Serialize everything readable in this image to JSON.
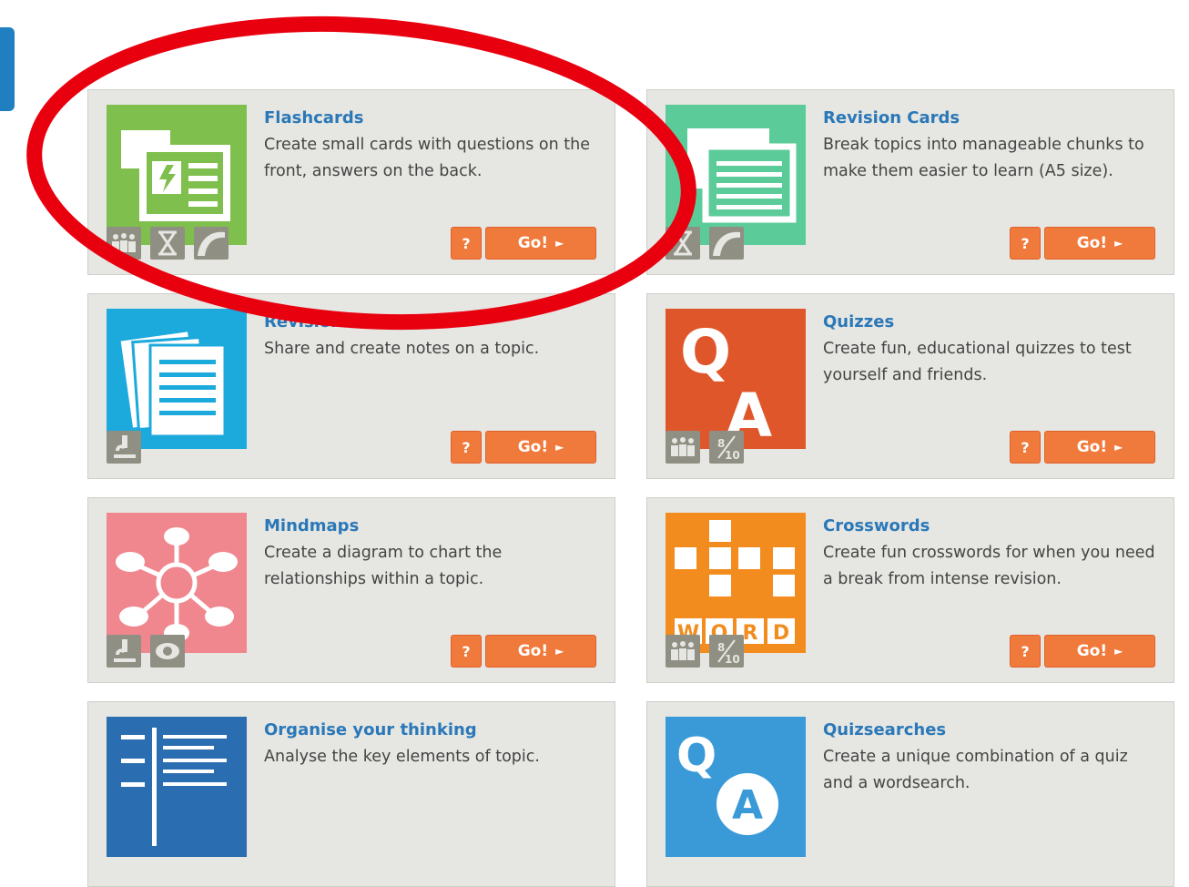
{
  "cards": [
    {
      "title": "Flashcards",
      "desc": "Create small cards with questions on the front, answers on the back.",
      "thumb_color": "#7fbf4d",
      "icon": "flashcards-icon",
      "features": [
        "group-icon",
        "hourglass-icon",
        "curve-icon"
      ]
    },
    {
      "title": "Revision Cards",
      "desc": "Break topics into manageable chunks to make them easier to learn (A5 size).",
      "thumb_color": "#5ccb9a",
      "icon": "revision-cards-icon",
      "features": [
        "hourglass-icon",
        "curve-icon"
      ]
    },
    {
      "title": "Revision notes",
      "desc": "Share and create notes on a topic.",
      "thumb_color": "#1ca9dc",
      "icon": "revision-notes-icon",
      "features": [
        "microscope-icon"
      ]
    },
    {
      "title": "Quizzes",
      "desc": "Create fun, educational quizzes to test yourself and friends.",
      "thumb_color": "#e0562b",
      "icon": "quiz-qa-icon",
      "features": [
        "group-icon",
        "score-icon"
      ]
    },
    {
      "title": "Mindmaps",
      "desc": "Create a diagram to chart the relationships within a topic.",
      "thumb_color": "#f0868e",
      "icon": "mindmap-icon",
      "features": [
        "microscope-icon",
        "eye-icon"
      ]
    },
    {
      "title": "Crosswords",
      "desc": "Create fun crosswords for when you need a break from intense revision.",
      "thumb_color": "#f28c1e",
      "icon": "crossword-icon",
      "features": [
        "group-icon",
        "score-icon"
      ]
    },
    {
      "title": "Organise your thinking",
      "desc": "Analyse the key elements of topic.",
      "thumb_color": "#2a6db0",
      "icon": "organise-icon",
      "features": []
    },
    {
      "title": "Quizsearches",
      "desc": "Create a unique combination of a quiz and a wordsearch.",
      "thumb_color": "#3a9ad8",
      "icon": "quizsearch-icon",
      "features": []
    }
  ],
  "buttons": {
    "help": "?",
    "go": "Go!",
    "go_arrow": "►"
  },
  "icon_text": {
    "score_num": "8",
    "score_den": "10",
    "quiz_q": "Q",
    "quiz_a": "A",
    "crossword_letters": [
      "W",
      "O",
      "R",
      "D"
    ]
  },
  "colors": {
    "card_bg": "#e6e6e2",
    "title": "#2a78b8",
    "button": "#f07a3c",
    "feature_icon": "#8f8f83",
    "annotation": "#e8000f"
  }
}
